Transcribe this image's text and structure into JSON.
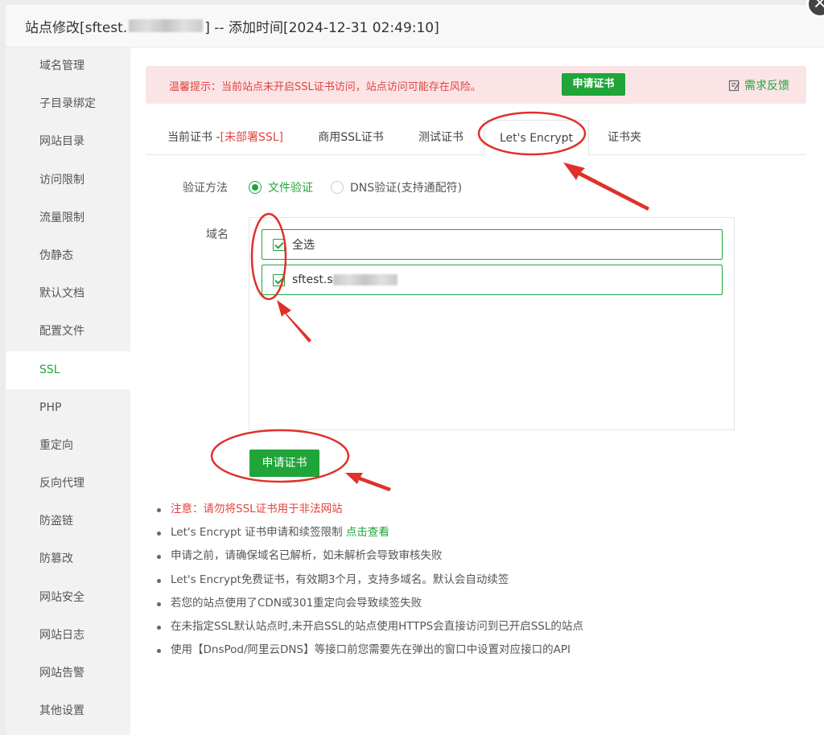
{
  "header": {
    "title_prefix": "站点修改[sftest.",
    "title_suffix": "] -- 添加时间[2024-12-31 02:49:10]"
  },
  "sidebar": {
    "items": [
      {
        "label": "域名管理"
      },
      {
        "label": "子目录绑定"
      },
      {
        "label": "网站目录"
      },
      {
        "label": "访问限制"
      },
      {
        "label": "流量限制"
      },
      {
        "label": "伪静态"
      },
      {
        "label": "默认文档"
      },
      {
        "label": "配置文件"
      },
      {
        "label": "SSL"
      },
      {
        "label": "PHP"
      },
      {
        "label": "重定向"
      },
      {
        "label": "反向代理"
      },
      {
        "label": "防盗链"
      },
      {
        "label": "防篡改"
      },
      {
        "label": "网站安全"
      },
      {
        "label": "网站日志"
      },
      {
        "label": "网站告警"
      },
      {
        "label": "其他设置"
      }
    ],
    "active": "SSL"
  },
  "warning": {
    "text": "温馨提示：当前站点未开启SSL证书访问，站点访问可能存在风险。",
    "button": "申请证书",
    "feedback": "需求反馈"
  },
  "tabs": {
    "current_label": "当前证书 -",
    "current_status": "[未部署SSL]",
    "commercial": "商用SSL证书",
    "test": "测试证书",
    "letsencrypt": "Let's Encrypt",
    "folder": "证书夹"
  },
  "form": {
    "verify_label": "验证方法",
    "verify_file": "文件验证",
    "verify_dns": "DNS验证(支持通配符)",
    "domain_label": "域名",
    "select_all": "全选",
    "domain_prefix": "sftest.s",
    "apply_button": "申请证书"
  },
  "notes": {
    "n1": "注意：请勿将SSL证书用于非法网站",
    "n2_text": "Let's Encrypt 证书申请和续签限制 ",
    "n2_link": "点击查看",
    "n3": "申请之前，请确保域名已解析，如未解析会导致审核失败",
    "n4": "Let's Encrypt免费证书，有效期3个月，支持多域名。默认会自动续签",
    "n5": "若您的站点使用了CDN或301重定向会导致续签失败",
    "n6": "在未指定SSL默认站点时,未开启SSL的站点使用HTTPS会直接访问到已开启SSL的站点",
    "n7": "使用【DnsPod/阿里云DNS】等接口前您需要先在弹出的窗口中设置对应接口的API"
  },
  "colors": {
    "accent": "#20a53a",
    "danger": "#e0443e",
    "annotation": "#e0302a"
  }
}
